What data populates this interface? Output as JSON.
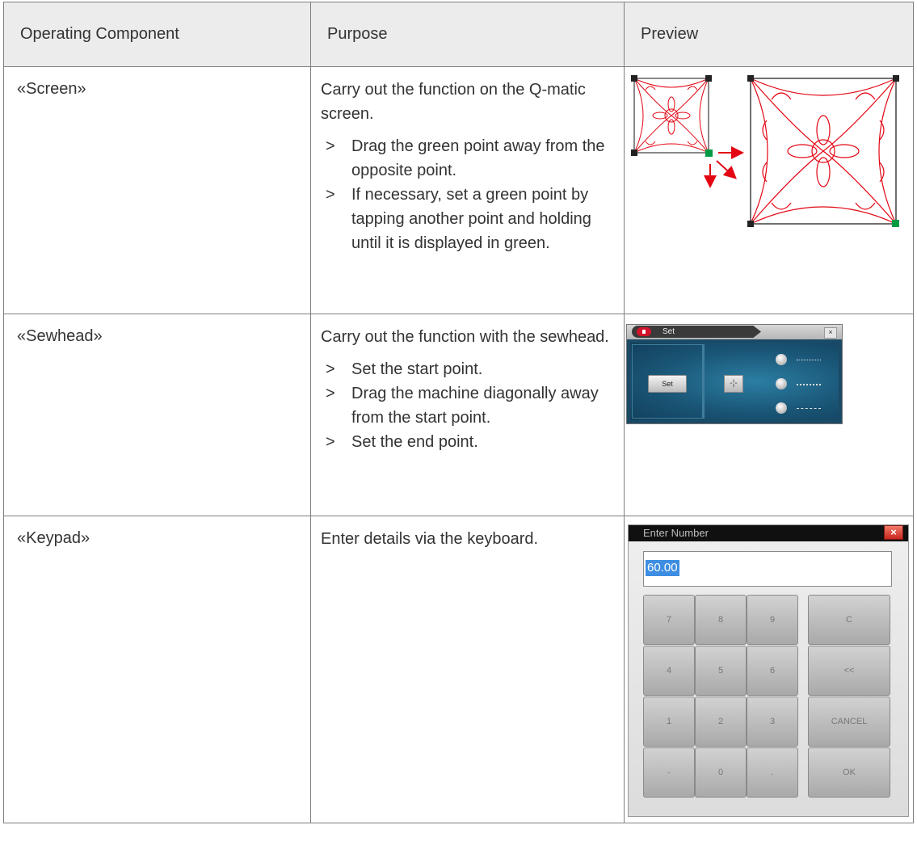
{
  "header": {
    "col1": "Operating Component",
    "col2": "Purpose",
    "col3": "Preview"
  },
  "rows": [
    {
      "component": "«Screen»",
      "intro": "Carry out the function on the Q-matic screen.",
      "steps": [
        "Drag the green point away from the opposite point.",
        "If necessary, set a green point by tapping another point and holding until it is displayed in green."
      ]
    },
    {
      "component": "«Sewhead»",
      "intro": "Carry out the function with the sewhead.",
      "steps": [
        "Set the start point.",
        "Drag the machine diagonally away from the start point.",
        "Set the end point."
      ]
    },
    {
      "component": "«Keypad»",
      "intro": "Enter details via the keyboard.",
      "steps": []
    }
  ],
  "bullet": ">",
  "sewhead_panel": {
    "title": "Set",
    "close": "×",
    "set_button": "Set",
    "cross_icon": "crosshair-icon"
  },
  "keypad": {
    "title": "Enter Number",
    "close": "×",
    "value": "60.00",
    "keys": [
      "7",
      "8",
      "9",
      "4",
      "5",
      "6",
      "1",
      "2",
      "3",
      "-",
      "0",
      "."
    ],
    "side_keys": [
      "C",
      "<<",
      "CANCEL",
      "OK"
    ]
  },
  "colors": {
    "accent_red": "#e30613",
    "green_point": "#009a44",
    "border": "#7f7f7f",
    "header_bg": "#ececec"
  }
}
